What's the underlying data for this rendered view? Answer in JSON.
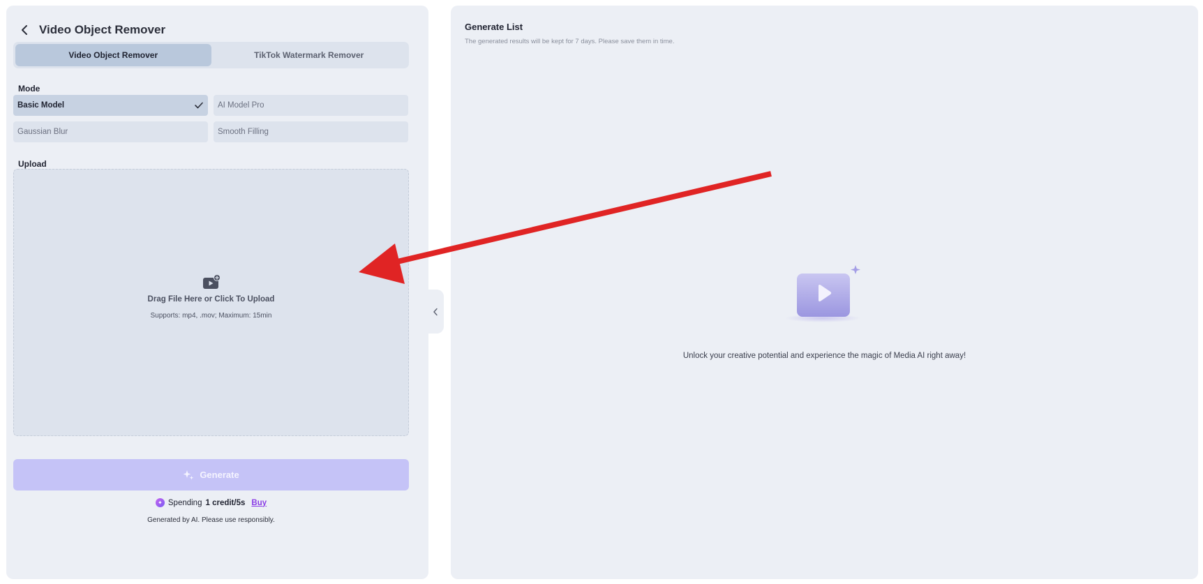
{
  "header": {
    "title": "Video Object Remover"
  },
  "tabs": [
    {
      "label": "Video Object Remover",
      "active": true
    },
    {
      "label": "TikTok Watermark Remover",
      "active": false
    }
  ],
  "mode": {
    "label": "Mode",
    "options": [
      {
        "label": "Basic Model",
        "selected": true
      },
      {
        "label": "AI Model Pro",
        "selected": false
      },
      {
        "label": "Gaussian Blur",
        "selected": false
      },
      {
        "label": "Smooth Filling",
        "selected": false
      }
    ]
  },
  "upload": {
    "label": "Upload",
    "title": "Drag File Here or Click To Upload",
    "hint": "Supports: mp4, .mov; Maximum: 15min",
    "icon": "video-upload-icon"
  },
  "generate": {
    "label": "Generate",
    "icon": "sparkle-icon"
  },
  "spending": {
    "prefix": "Spending",
    "amount": "1 credit/5s",
    "buy_label": "Buy"
  },
  "disclaimer": "Generated by AI. Please use responsibly.",
  "generate_list": {
    "title": "Generate List",
    "subtitle": "The generated results will be kept for 7 days. Please save them in time.",
    "empty_text": "Unlock your creative potential and experience the magic of Media AI right away!"
  },
  "colors": {
    "accent": "#c5c3f7",
    "buy_link": "#8b3ee6",
    "annotation_arrow": "#e02424",
    "panel_bg": "#eceff5"
  }
}
